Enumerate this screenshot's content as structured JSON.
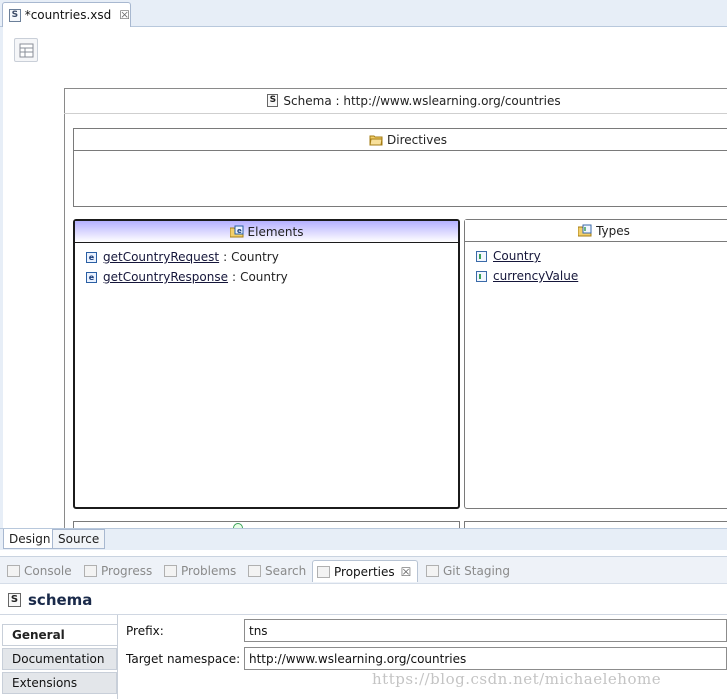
{
  "editor": {
    "tab_title": "*countries.xsd",
    "tab_icon_letter": "S",
    "close_glyph": "☒"
  },
  "schema": {
    "icon_letter": "S",
    "header": "Schema : http://www.wslearning.org/countries",
    "directives_title": "Directives",
    "elements_title": "Elements",
    "types_title": "Types",
    "elements": [
      {
        "name": "getCountryRequest",
        "sep": ":",
        "type": "Country"
      },
      {
        "name": "getCountryResponse",
        "sep": ":",
        "type": "Country"
      }
    ],
    "types": [
      {
        "name": "Country"
      },
      {
        "name": "currencyValue"
      }
    ]
  },
  "bottom_tabs": {
    "design": "Design",
    "source": "Source"
  },
  "views": {
    "tabs": [
      {
        "label": "Console",
        "icon": "console-icon"
      },
      {
        "label": "Progress",
        "icon": "progress-icon"
      },
      {
        "label": "Problems",
        "icon": "problems-icon"
      },
      {
        "label": "Search",
        "icon": "search-icon"
      },
      {
        "label": "Properties",
        "icon": "properties-icon"
      },
      {
        "label": "Git Staging",
        "icon": "git-staging-icon"
      }
    ],
    "close_glyph": "☒"
  },
  "properties": {
    "icon_letter": "S",
    "title": "schema",
    "side_tabs": [
      "General",
      "Documentation",
      "Extensions"
    ],
    "prefix_label": "Prefix:",
    "prefix_value": "tns",
    "namespace_label": "Target namespace:",
    "namespace_value": "http://www.wslearning.org/countries"
  },
  "watermark": "https://blog.csdn.net/michaelehome",
  "colors": {
    "elements_header_gradient": "#b5b0ff",
    "tab_bar": "#e7eef7",
    "link_text": "#15163a"
  }
}
